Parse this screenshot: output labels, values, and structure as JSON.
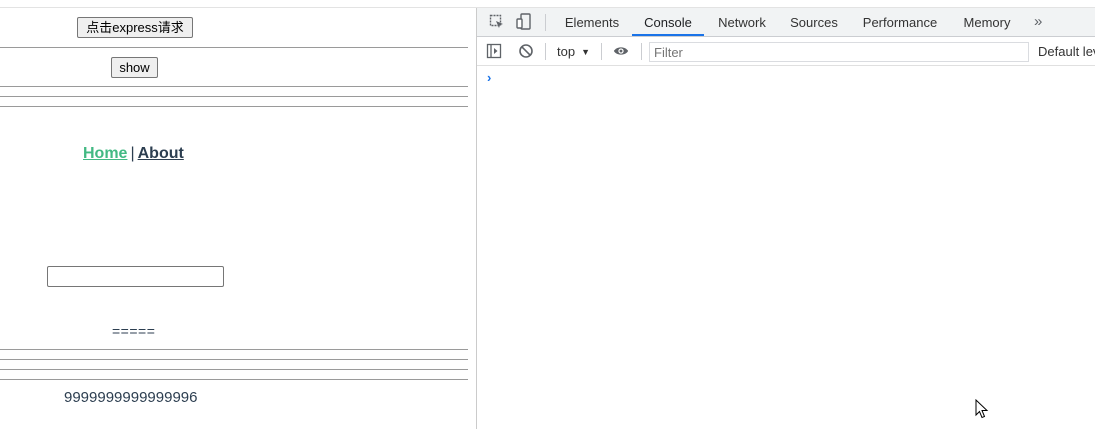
{
  "page": {
    "express_button": "点击express请求",
    "show_button": "show",
    "nav": {
      "home": "Home",
      "separator": "|",
      "about": "About"
    },
    "input_value": "",
    "equals_text": "=====",
    "number_text": "9999999999999996"
  },
  "devtools": {
    "tabs": [
      {
        "label": "Elements"
      },
      {
        "label": "Console"
      },
      {
        "label": "Network"
      },
      {
        "label": "Sources"
      },
      {
        "label": "Performance"
      },
      {
        "label": "Memory"
      }
    ],
    "active_tab": "Console",
    "more_tabs": "»",
    "context": "top",
    "filter_placeholder": "Filter",
    "levels": "Default lev",
    "prompt_symbol": "›"
  },
  "colors": {
    "link_home": "#42b983",
    "link_about": "#2c3e50",
    "active_tab_underline": "#1a73e8"
  }
}
